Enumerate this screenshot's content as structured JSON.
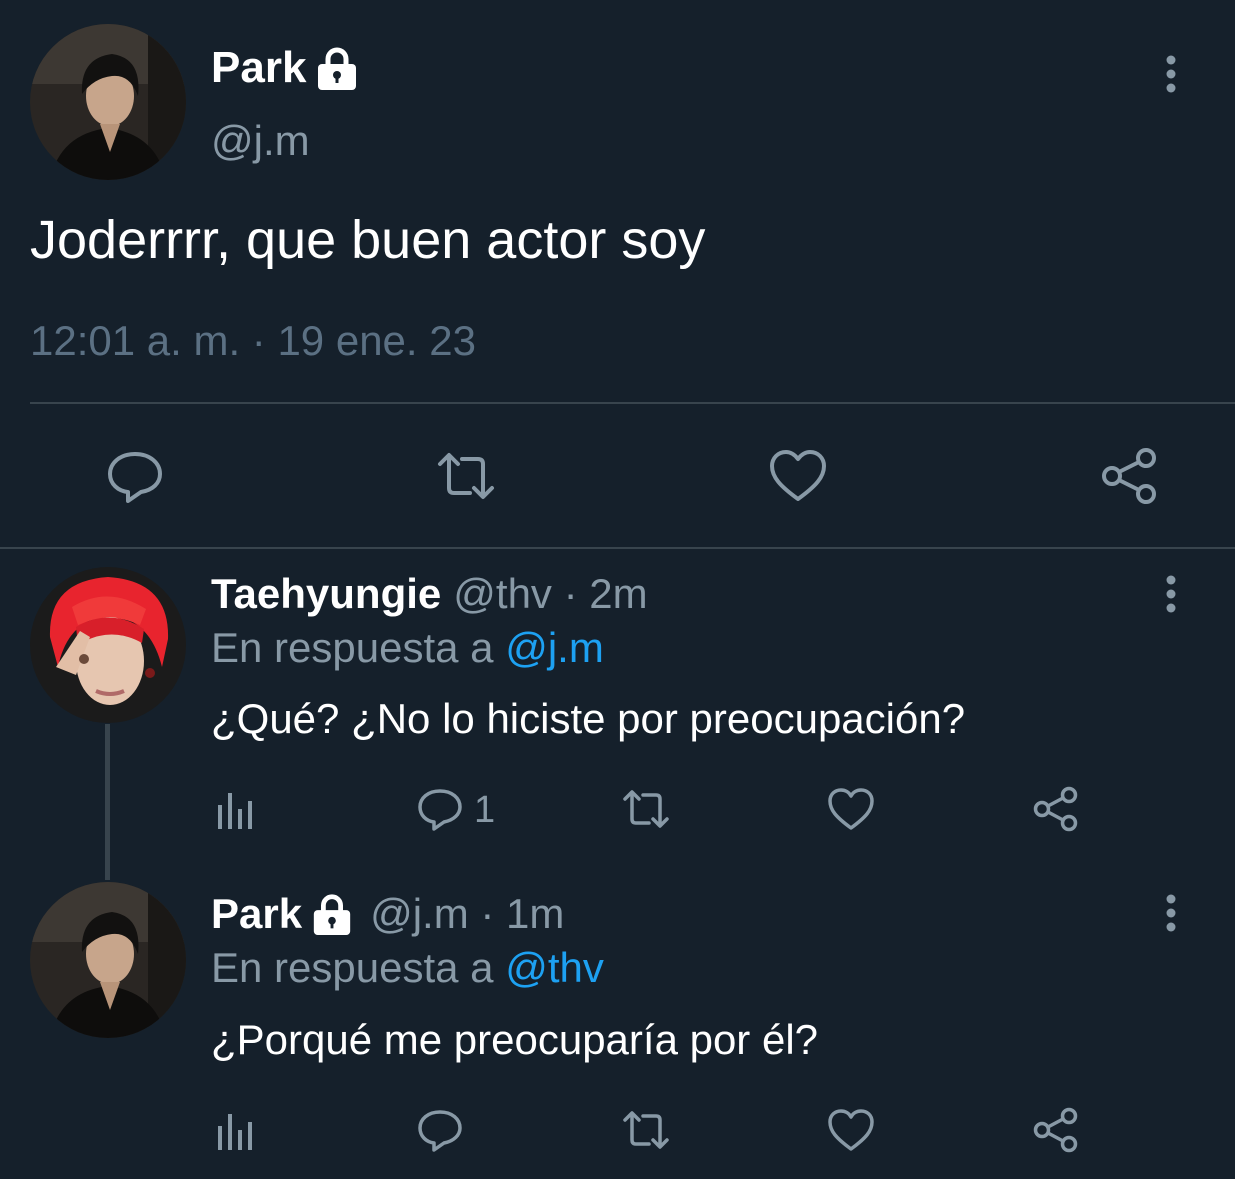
{
  "main_tweet": {
    "author_name": "Park",
    "author_handle": "@j.m",
    "text": "Joderrrr, que buen actor soy",
    "timestamp": "12:01 a. m. · 19 ene. 23",
    "avatar_icon": "person-avatar-dark-hair",
    "lock_icon": "lock-icon",
    "actions": [
      "reply-icon",
      "retweet-icon",
      "like-icon",
      "share-icon"
    ]
  },
  "replies": [
    {
      "author_name": "Taehyungie",
      "meta": "@thv · 2m",
      "reply_to_prefix": "En respuesta a",
      "reply_to_mention": "@j.m",
      "text": "¿Qué? ¿No lo hiciste por preocupación?",
      "reply_count": "1",
      "avatar_icon": "person-avatar-red-hair"
    },
    {
      "author_name": "Park",
      "meta": "@j.m · 1m",
      "reply_to_prefix": "En respuesta a",
      "reply_to_mention": "@thv",
      "text": "¿Porqué me preocuparía por él?",
      "reply_count": "",
      "avatar_icon": "person-avatar-dark-hair"
    }
  ],
  "colors": {
    "background": "#15202b",
    "text_primary": "#ffffff",
    "text_secondary": "#8899a6",
    "text_muted": "#5b7083",
    "link": "#1da1f2",
    "divider": "#38444d",
    "icon": "#8899a6"
  }
}
